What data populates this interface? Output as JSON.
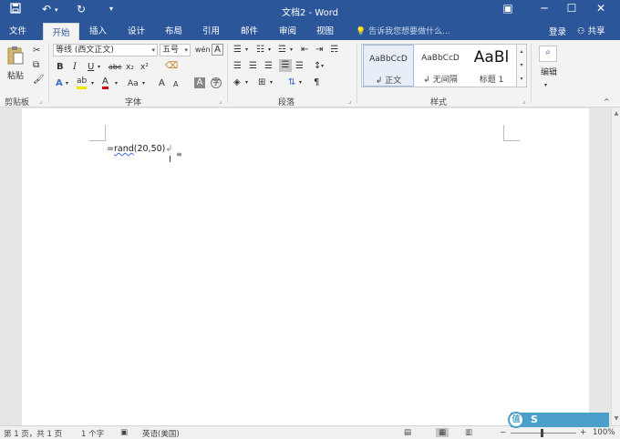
{
  "titlebar": {
    "title": "文档2 - Word",
    "qa_save_icon": "save-icon",
    "qa_undo_icon": "undo-icon",
    "qa_redo_icon": "redo-icon",
    "qa_customize_icon": "customize-qat-icon",
    "ribbon_display": "▣",
    "minimize": "─",
    "maximize": "☐",
    "close": "✕"
  },
  "tabs": [
    {
      "label": "文件"
    },
    {
      "label": "开始"
    },
    {
      "label": "插入"
    },
    {
      "label": "设计"
    },
    {
      "label": "布局"
    },
    {
      "label": "引用"
    },
    {
      "label": "邮件"
    },
    {
      "label": "审阅"
    },
    {
      "label": "视图"
    }
  ],
  "tellme": {
    "placeholder": "告诉我您想要做什么..."
  },
  "account": {
    "login": "登录",
    "share": "共享"
  },
  "clipboard": {
    "paste": "粘贴",
    "label": "剪贴板"
  },
  "font": {
    "name": "等线 (西文正文)",
    "size": "五号",
    "label": "字体",
    "bold": "B",
    "italic": "I",
    "underline": "U",
    "strike": "abc",
    "subscript": "x₂",
    "superscript": "x²",
    "grow": "A",
    "shrink": "A",
    "case": "Aa",
    "color_letter": "A",
    "highlight": "ab",
    "clear": "A"
  },
  "paragraph": {
    "label": "段落"
  },
  "styles": {
    "label": "样式",
    "items": [
      {
        "sample": "AaBbCcD",
        "name": "↲ 正文"
      },
      {
        "sample": "AaBbCcD",
        "name": "↲ 无间隔"
      },
      {
        "sample": "AaBl",
        "name": "标题 1"
      }
    ]
  },
  "editing": {
    "label": "编辑"
  },
  "document": {
    "text_prefix": "=",
    "text_func": "rand",
    "text_args": "(20,50)",
    "para_mark": "↲"
  },
  "status": {
    "page": "第 1 页，共 1 页",
    "words": "1 个字",
    "language": "英语(美国)",
    "zoom": "100%"
  },
  "watermark": {
    "circle": "值",
    "text": "S"
  }
}
